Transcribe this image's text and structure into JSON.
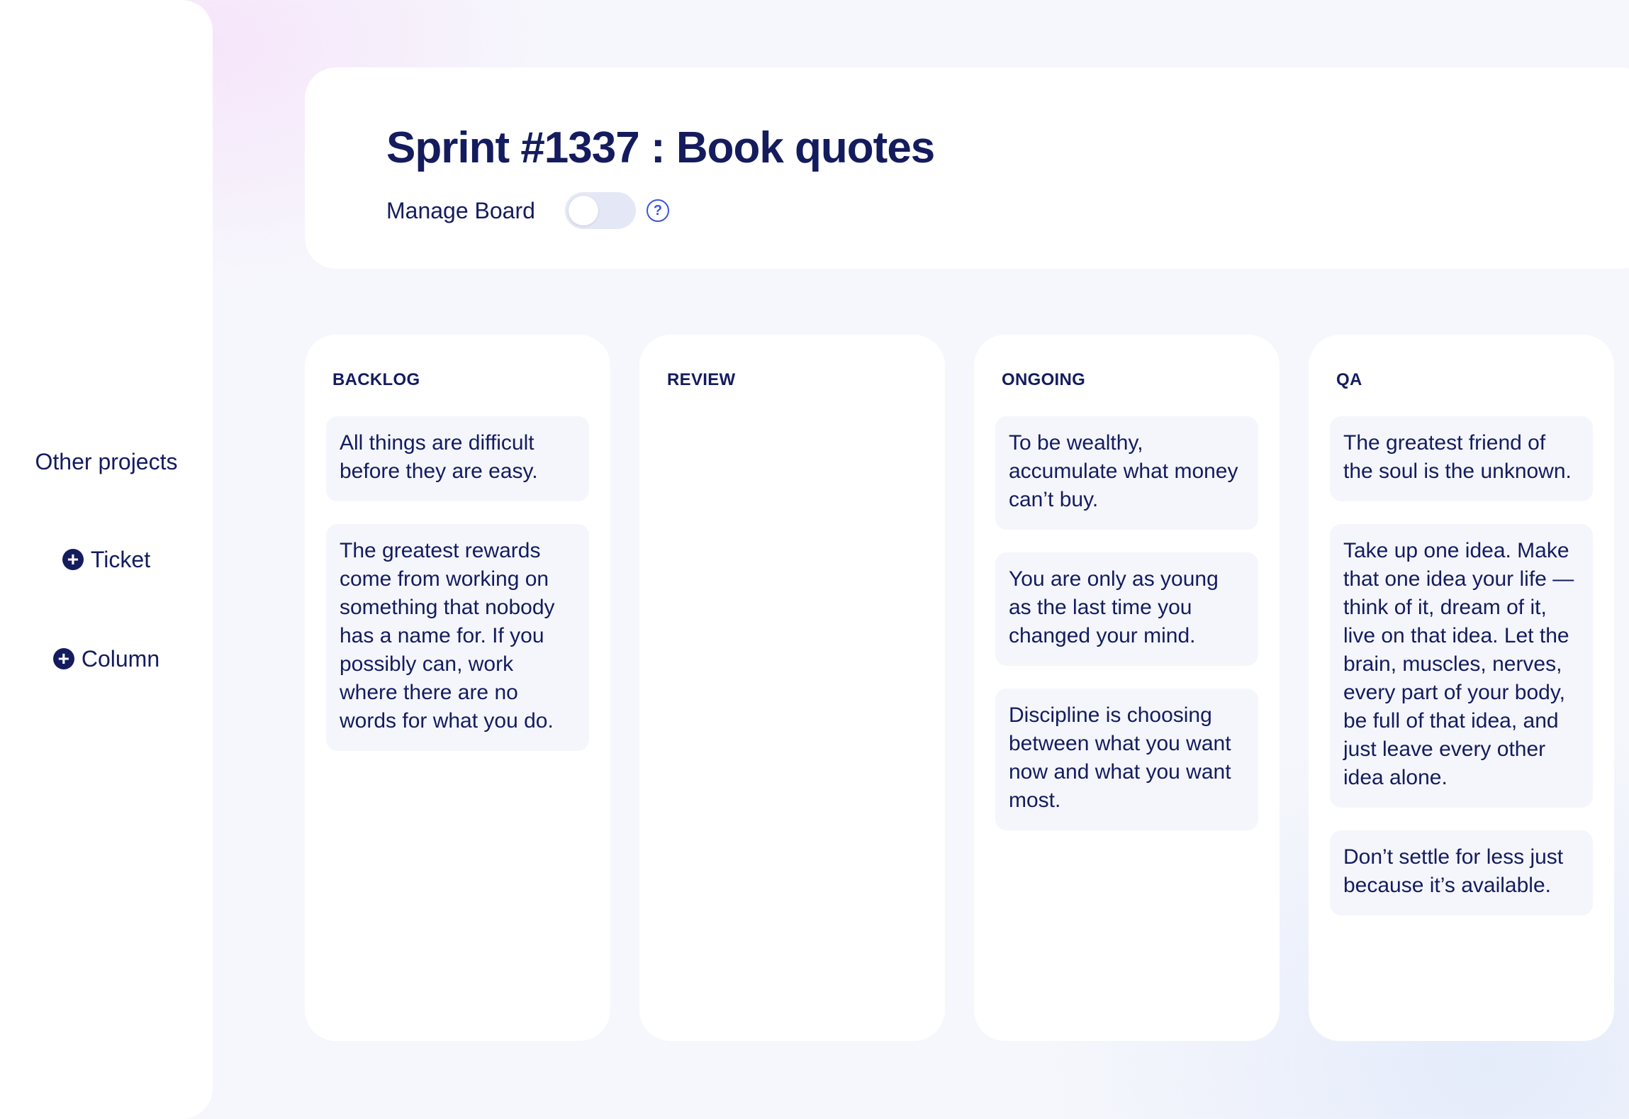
{
  "sidebar": {
    "other_projects": "Other projects",
    "add_ticket": "Ticket",
    "add_column": "Column",
    "plus_icon": "plus-circle-icon"
  },
  "header": {
    "title": "Sprint #1337 : Book quotes",
    "manage_board_label": "Manage Board",
    "manage_board_enabled": false,
    "help_icon": "question-circle-icon",
    "help_glyph": "?"
  },
  "columns": [
    {
      "title": "BACKLOG",
      "cards": [
        "All things are difficult before they are easy.",
        "The greatest rewards come from working on something that nobody has a name for. If you possibly can, work where there are no words for what you do."
      ]
    },
    {
      "title": "REVIEW",
      "cards": []
    },
    {
      "title": "ONGOING",
      "cards": [
        "To be wealthy, accumulate what money can’t buy.",
        "You are only as young as the last time you changed your mind.",
        "Discipline is choosing between what you want now and what you want most."
      ]
    },
    {
      "title": "QA",
      "cards": [
        "The greatest friend of the soul is the unknown.",
        "Take up one idea. Make that one idea your life — think of it, dream of it, live on that idea. Let the brain, muscles, nerves, every part of your body, be full of that idea, and just leave every other idea alone.",
        "Don’t settle for less just because it’s available."
      ]
    }
  ],
  "colors": {
    "text": "#141c5e",
    "accent": "#3c56d8",
    "card_bg": "#f4f6fc",
    "toggle_bg": "#e4e8f6"
  }
}
